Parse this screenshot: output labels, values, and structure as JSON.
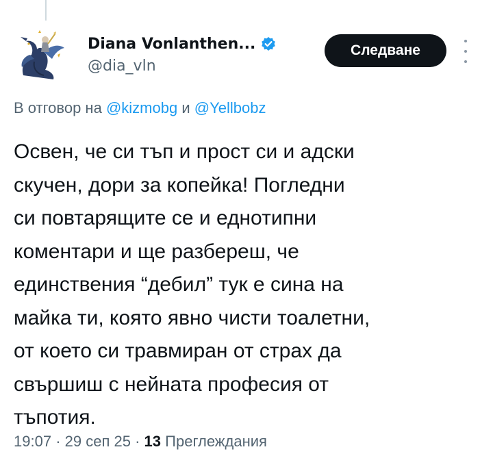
{
  "author": {
    "display_name": "Diana Vonlanthen...",
    "handle": "@dia_vln",
    "verified": true,
    "avatar_icon": "dragon-warrior-avatar"
  },
  "follow_button": {
    "label": "Следване"
  },
  "reply_context": {
    "prefix": "В отговор на",
    "mention_1": "@kizmobg",
    "joiner": "и",
    "mention_2": "@Yellbobz"
  },
  "tweet": {
    "lines": [
      "Освен, че си тъп и прост си и адски",
      "скучен, дори за копейка! Погледни",
      "си повтарящите се и еднотипни",
      "коментари и ще разбереш, че",
      "единствения “дебил” тук е сина на",
      "майка ти, която явно чисти тоалетни,",
      "от което си травмиран от страх да",
      "свършиш с нейната професия от",
      "тъпотия."
    ]
  },
  "meta": {
    "time": "19:07",
    "separator": "·",
    "date": "29 сеп 25",
    "views_count": "13",
    "views_label": "Преглеждания"
  },
  "colors": {
    "text": "#0f1419",
    "secondary": "#536471",
    "link": "#1d9bf0",
    "verified_badge": "#1d9bf0",
    "button_bg": "#0f1419"
  }
}
